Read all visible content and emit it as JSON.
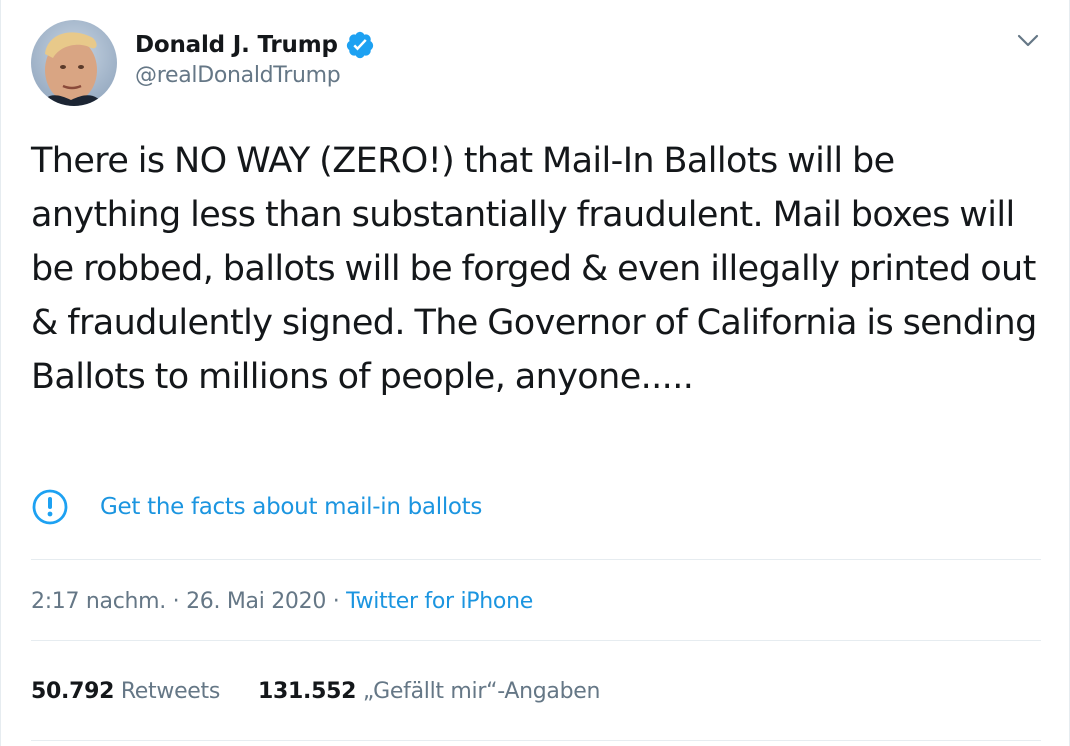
{
  "user": {
    "display_name": "Donald J. Trump",
    "handle": "@realDonaldTrump",
    "verified": true
  },
  "tweet": {
    "text": "There is NO WAY (ZERO!) that Mail-In Ballots will be anything less than substantially fraudulent. Mail boxes will be robbed, ballots will be forged & even illegally printed out & fraudulently signed. The Governor of California is sending Ballots to millions of people, anyone....."
  },
  "fact_check": {
    "label": "Get the facts about mail-in ballots",
    "icon": "exclamation-circle-icon"
  },
  "meta": {
    "time": "2:17 nachm.",
    "separator1": " · ",
    "date": "26. Mai 2020",
    "separator2": " · ",
    "source": "Twitter for iPhone"
  },
  "stats": {
    "retweets_count": "50.792",
    "retweets_label": "Retweets",
    "likes_count": "131.552",
    "likes_label": "„Gefällt mir“-Angaben"
  },
  "colors": {
    "link": "#1b95e0",
    "secondary": "#657786",
    "primary_text": "#14171a",
    "divider": "#e6ecf0"
  }
}
